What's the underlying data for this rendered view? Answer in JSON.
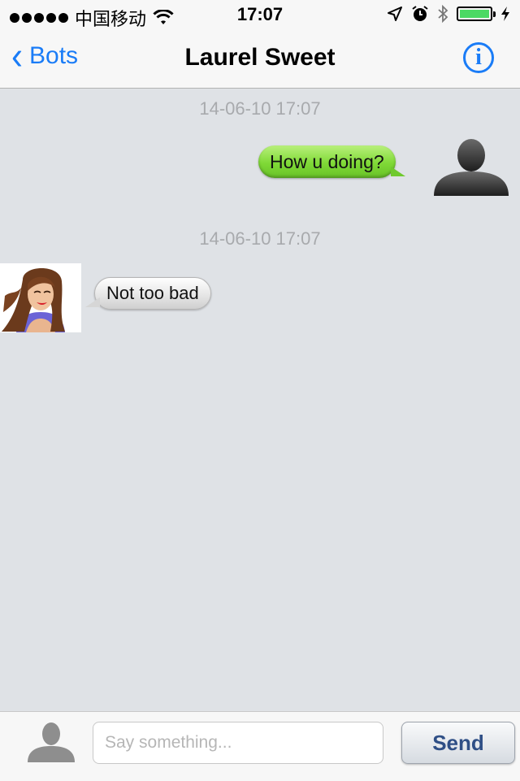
{
  "status_bar": {
    "carrier": "中国移动",
    "time": "17:07",
    "icons": [
      "signal-dots-icon",
      "wifi-icon",
      "location-arrow-icon",
      "alarm-icon",
      "bluetooth-icon",
      "battery-icon",
      "charging-bolt-icon"
    ]
  },
  "nav": {
    "back_label": "Bots",
    "title": "Laurel Sweet",
    "info_icon": "info-icon"
  },
  "messages": [
    {
      "timestamp": "14-06-10 17:07",
      "sender": "me",
      "text": "How u doing?"
    },
    {
      "timestamp": "14-06-10 17:07",
      "sender": "bot",
      "text": "Not too bad"
    }
  ],
  "input": {
    "placeholder": "Say something...",
    "value": "",
    "send_label": "Send"
  },
  "colors": {
    "accent": "#1a7cf7",
    "chat_background": "#dfe2e6",
    "outgoing_bubble": "#7fd936",
    "incoming_bubble": "#e4e4e4",
    "send_text": "#2f4f86"
  }
}
